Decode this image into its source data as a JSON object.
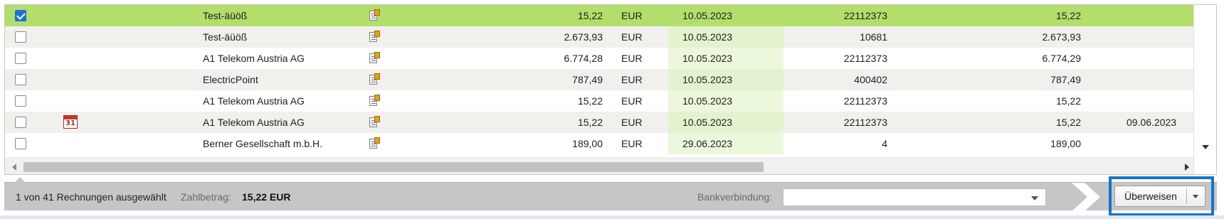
{
  "rows": [
    {
      "checked": true,
      "calendar": false,
      "name": "Test-äüöß",
      "amount": "15,22",
      "currency": "EUR",
      "date": "10.05.2023",
      "reference": "22112373",
      "open_amount": "15,22",
      "due_date": ""
    },
    {
      "checked": false,
      "calendar": false,
      "name": "Test-äüöß",
      "amount": "2.673,93",
      "currency": "EUR",
      "date": "10.05.2023",
      "reference": "10681",
      "open_amount": "2.673,93",
      "due_date": ""
    },
    {
      "checked": false,
      "calendar": false,
      "name": "A1 Telekom Austria AG",
      "amount": "6.774,28",
      "currency": "EUR",
      "date": "10.05.2023",
      "reference": "22112373",
      "open_amount": "6.774,29",
      "due_date": ""
    },
    {
      "checked": false,
      "calendar": false,
      "name": "ElectricPoint",
      "amount": "787,49",
      "currency": "EUR",
      "date": "10.05.2023",
      "reference": "400402",
      "open_amount": "787,49",
      "due_date": ""
    },
    {
      "checked": false,
      "calendar": false,
      "name": "A1 Telekom Austria AG",
      "amount": "15,22",
      "currency": "EUR",
      "date": "10.05.2023",
      "reference": "22112373",
      "open_amount": "15,22",
      "due_date": ""
    },
    {
      "checked": false,
      "calendar": true,
      "calendar_day": "31",
      "name": "A1 Telekom Austria AG",
      "amount": "15,22",
      "currency": "EUR",
      "date": "10.05.2023",
      "reference": "22112373",
      "open_amount": "15,22",
      "due_date": "09.06.2023"
    },
    {
      "checked": false,
      "calendar": false,
      "name": "Berner Gesellschaft m.b.H.",
      "amount": "189,00",
      "currency": "EUR",
      "date": "29.06.2023",
      "reference": "4",
      "open_amount": "189,00",
      "due_date": ""
    }
  ],
  "footer": {
    "selection_text": "1 von 41 Rechnungen ausgewählt",
    "zahlbetrag_label": "Zahlbetrag:",
    "zahlbetrag_value": "15,22 EUR",
    "bank_label": "Bankverbindung:",
    "bank_value": "",
    "transfer_button": "Überweisen"
  },
  "colors": {
    "selected_row": "#b3de6b",
    "date_highlight": "#ecf8dc",
    "focus_border": "#1673c9",
    "checkbox_checked": "#1f6fd1"
  }
}
